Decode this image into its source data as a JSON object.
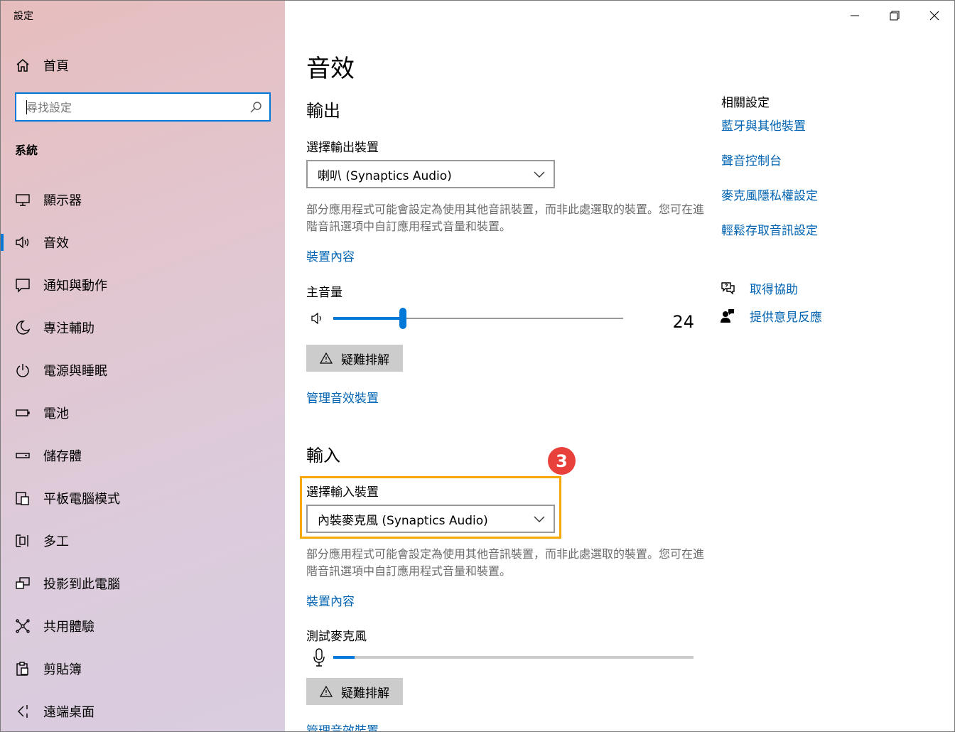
{
  "window": {
    "title": "設定",
    "controls": [
      "minimize-icon",
      "maximize-icon",
      "close-icon"
    ]
  },
  "sidebar": {
    "home_label": "首頁",
    "search_placeholder": "尋找設定",
    "section_title": "系統",
    "items": [
      {
        "label": "顯示器",
        "icon": "display-icon"
      },
      {
        "label": "音效",
        "icon": "speaker-icon",
        "active": true
      },
      {
        "label": "通知與動作",
        "icon": "notification-icon"
      },
      {
        "label": "專注輔助",
        "icon": "moon-icon"
      },
      {
        "label": "電源與睡眠",
        "icon": "power-icon"
      },
      {
        "label": "電池",
        "icon": "battery-icon"
      },
      {
        "label": "儲存體",
        "icon": "storage-icon"
      },
      {
        "label": "平板電腦模式",
        "icon": "tablet-icon"
      },
      {
        "label": "多工",
        "icon": "multitask-icon"
      },
      {
        "label": "投影到此電腦",
        "icon": "project-icon"
      },
      {
        "label": "共用體驗",
        "icon": "shared-icon"
      },
      {
        "label": "剪貼簿",
        "icon": "clipboard-icon"
      },
      {
        "label": "遠端桌面",
        "icon": "remote-desktop-icon"
      }
    ]
  },
  "main": {
    "title": "音效",
    "output": {
      "heading": "輸出",
      "select_label": "選擇輸出裝置",
      "selected_device": "喇叭 (Synaptics Audio)",
      "description": "部分應用程式可能會設定為使用其他音訊裝置，而非此處選取的裝置。您可在進階音訊選項中自訂應用程式音量和裝置。",
      "properties_link": "裝置內容",
      "volume_label": "主音量",
      "volume_value": 24,
      "troubleshoot_label": "疑難排解",
      "manage_link": "管理音效裝置"
    },
    "input": {
      "heading": "輸入",
      "select_label": "選擇輸入裝置",
      "selected_device": "內裝麥克風 (Synaptics Audio)",
      "description": "部分應用程式可能會設定為使用其他音訊裝置，而非此處選取的裝置。您可在進階音訊選項中自訂應用程式音量和裝置。",
      "properties_link": "裝置內容",
      "test_label": "測試麥克風",
      "mic_level": 6,
      "troubleshoot_label": "疑難排解",
      "manage_link": "管理音效裝置"
    },
    "annotation": {
      "step_number": "3",
      "highlight_color": "#f5a800",
      "badge_color": "#e8413c"
    }
  },
  "related": {
    "heading": "相關設定",
    "links": [
      "藍牙與其他裝置",
      "聲音控制台",
      "麥克風隱私權設定",
      "輕鬆存取音訊設定"
    ],
    "help": {
      "get_help": "取得協助",
      "feedback": "提供意見反應"
    }
  },
  "colors": {
    "accent": "#0078d7",
    "link": "#0063b1"
  }
}
